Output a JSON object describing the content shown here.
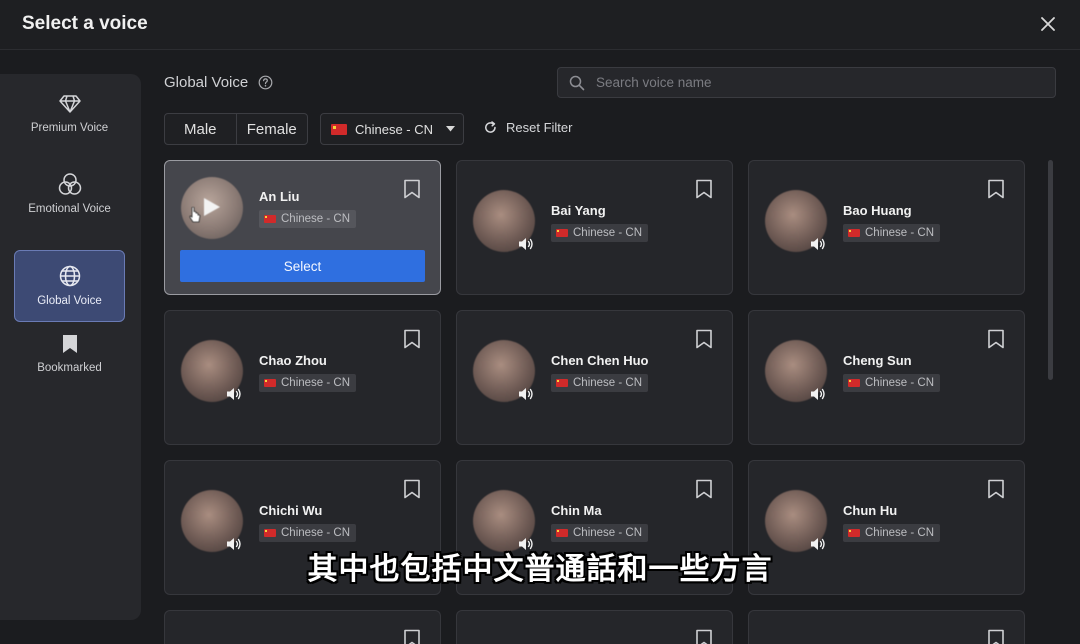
{
  "dialog": {
    "title": "Select a voice"
  },
  "sidebar": {
    "items": [
      {
        "label": "Premium Voice",
        "icon": "diamond-icon",
        "active": false
      },
      {
        "label": "Emotional Voice",
        "icon": "circles-icon",
        "active": false
      },
      {
        "label": "Global Voice",
        "icon": "globe-icon",
        "active": true
      },
      {
        "label": "Bookmarked",
        "icon": "bookmark-icon",
        "active": false
      }
    ]
  },
  "main": {
    "title": "Global Voice",
    "search": {
      "placeholder": "Search voice name",
      "value": ""
    },
    "filters": {
      "gender": [
        "Male",
        "Female"
      ],
      "language": "Chinese - CN",
      "reset_label": "Reset Filter"
    },
    "select_label": "Select",
    "voices": [
      {
        "name": "An Liu",
        "lang": "Chinese - CN",
        "selected": true
      },
      {
        "name": "Bai Yang",
        "lang": "Chinese - CN",
        "selected": false
      },
      {
        "name": "Bao Huang",
        "lang": "Chinese - CN",
        "selected": false
      },
      {
        "name": "Chao Zhou",
        "lang": "Chinese - CN",
        "selected": false
      },
      {
        "name": "Chen Chen Huo",
        "lang": "Chinese - CN",
        "selected": false
      },
      {
        "name": "Cheng Sun",
        "lang": "Chinese - CN",
        "selected": false
      },
      {
        "name": "Chichi Wu",
        "lang": "Chinese - CN",
        "selected": false
      },
      {
        "name": "Chin Ma",
        "lang": "Chinese - CN",
        "selected": false
      },
      {
        "name": "Chun Hu",
        "lang": "Chinese - CN",
        "selected": false
      }
    ]
  },
  "subtitle": "其中也包括中文普通話和一些方言",
  "colors": {
    "accent": "#2f6fe0",
    "active_nav": "#3d4a74",
    "flag_red": "#d12a2a"
  }
}
